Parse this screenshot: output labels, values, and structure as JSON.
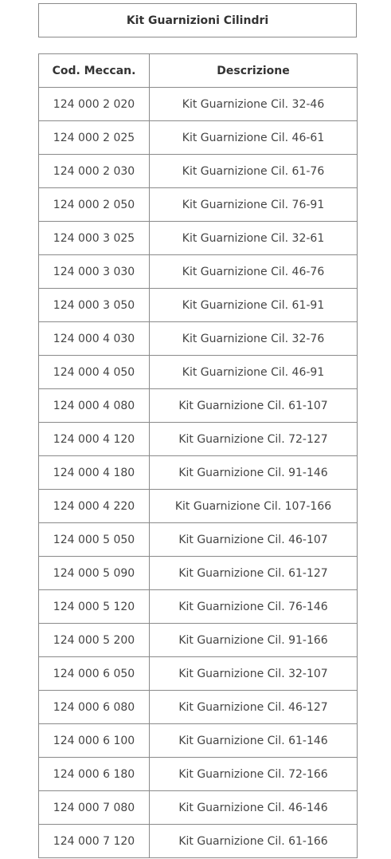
{
  "title": "Kit Guarnizioni Cilindri",
  "table": {
    "headers": [
      "Cod. Meccan.",
      "Descrizione"
    ],
    "rows": [
      [
        "124 000 2 020",
        "Kit Guarnizione Cil. 32-46"
      ],
      [
        "124 000 2 025",
        "Kit Guarnizione Cil. 46-61"
      ],
      [
        "124 000 2 030",
        "Kit Guarnizione Cil. 61-76"
      ],
      [
        "124 000 2 050",
        "Kit Guarnizione Cil. 76-91"
      ],
      [
        "124 000 3 025",
        "Kit Guarnizione Cil. 32-61"
      ],
      [
        "124 000 3 030",
        "Kit Guarnizione Cil. 46-76"
      ],
      [
        "124 000 3 050",
        "Kit Guarnizione Cil. 61-91"
      ],
      [
        "124 000 4 030",
        "Kit Guarnizione Cil. 32-76"
      ],
      [
        "124 000 4 050",
        "Kit Guarnizione Cil. 46-91"
      ],
      [
        "124 000 4 080",
        "Kit Guarnizione Cil. 61-107"
      ],
      [
        "124 000 4 120",
        "Kit Guarnizione Cil. 72-127"
      ],
      [
        "124 000 4 180",
        "Kit Guarnizione Cil. 91-146"
      ],
      [
        "124 000 4 220",
        "Kit Guarnizione Cil. 107-166"
      ],
      [
        "124 000 5 050",
        "Kit Guarnizione Cil. 46-107"
      ],
      [
        "124 000 5 090",
        "Kit Guarnizione Cil. 61-127"
      ],
      [
        "124 000 5 120",
        "Kit Guarnizione Cil. 76-146"
      ],
      [
        "124 000 5 200",
        "Kit Guarnizione Cil. 91-166"
      ],
      [
        "124 000 6 050",
        "Kit Guarnizione Cil. 32-107"
      ],
      [
        "124 000 6 080",
        "Kit Guarnizione Cil. 46-127"
      ],
      [
        "124 000 6 100",
        "Kit Guarnizione Cil. 61-146"
      ],
      [
        "124 000 6 180",
        "Kit Guarnizione Cil. 72-166"
      ],
      [
        "124 000 7 080",
        "Kit Guarnizione Cil. 46-146"
      ],
      [
        "124 000 7 120",
        "Kit Guarnizione Cil. 61-166"
      ]
    ]
  }
}
